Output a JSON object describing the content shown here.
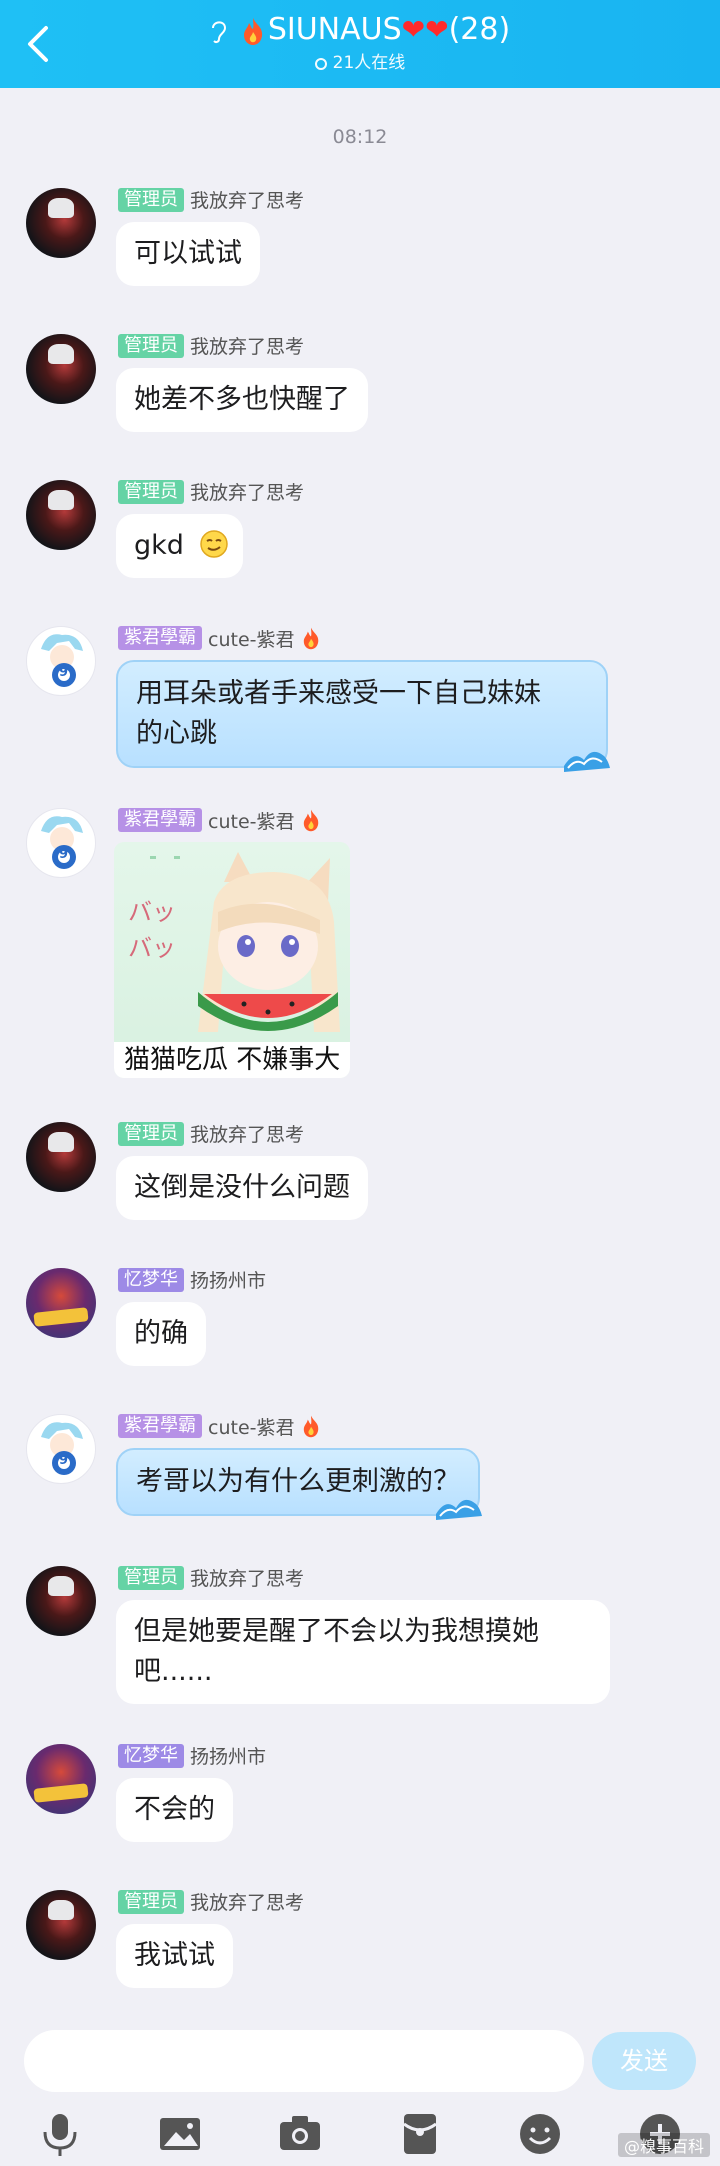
{
  "header": {
    "title": "SIUNAUS",
    "hearts": "❤❤",
    "count": "(28)",
    "online": "21人在线"
  },
  "timestamp": "08:12",
  "messages": [
    {
      "badge": "管理员",
      "name": "我放弃了思考",
      "text": "可以试试"
    },
    {
      "badge": "管理员",
      "name": "我放弃了思考",
      "text": "她差不多也快醒了"
    },
    {
      "badge": "管理员",
      "name": "我放弃了思考",
      "text": "gkd"
    },
    {
      "badge": "紫君學霸",
      "name": "cute-紫君",
      "text_line1": "用耳朵或者手来感受一下自己妹妹",
      "text_line2": "的心跳"
    },
    {
      "badge": "紫君學霸",
      "name": "cute-紫君",
      "sticker_caption": "猫猫吃瓜 不嫌事大",
      "sticker_text": "バッ"
    },
    {
      "badge": "管理员",
      "name": "我放弃了思考",
      "text": "这倒是没什么问题"
    },
    {
      "badge": "忆梦华",
      "name": "扬扬州市",
      "text": "的确"
    },
    {
      "badge": "紫君學霸",
      "name": "cute-紫君",
      "text": "考哥以为有什么更刺激的？"
    },
    {
      "badge": "管理员",
      "name": "我放弃了思考",
      "text_line1": "但是她要是醒了不会以为我想摸她",
      "text_line2": "吧......"
    },
    {
      "badge": "忆梦华",
      "name": "扬扬州市",
      "text": "不会的"
    },
    {
      "badge": "管理员",
      "name": "我放弃了思考",
      "text": "我试试"
    }
  ],
  "avatar_labels": {
    "zijun": "9"
  },
  "input": {
    "placeholder": "",
    "send_label": "发送"
  },
  "toolbar_icons": [
    "microphone-icon",
    "image-icon",
    "camera-icon",
    "red-packet-icon",
    "emoji-icon",
    "plus-icon"
  ],
  "watermark": "@糗事百科",
  "colors": {
    "header": "#1fc0f5",
    "admin_badge": "#65d3a5",
    "title_badge": "#b691e6",
    "send": "#bfe6fb"
  }
}
